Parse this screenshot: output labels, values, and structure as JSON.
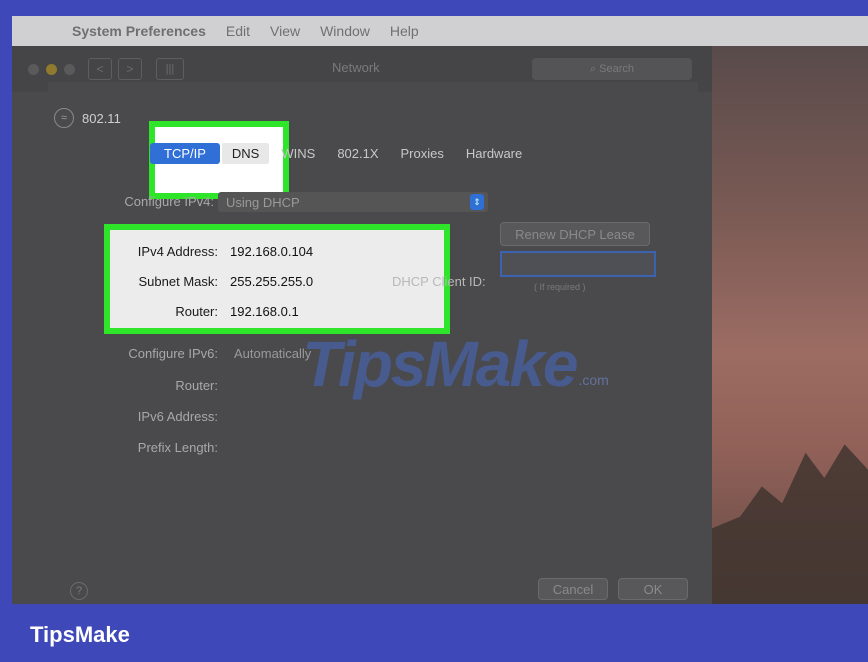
{
  "menubar": {
    "apple": "",
    "items": [
      "System Preferences",
      "Edit",
      "View",
      "Window",
      "Help"
    ]
  },
  "window": {
    "title": "Network",
    "search_placeholder": "Search",
    "nav_back": "<",
    "nav_forward": ">",
    "grid": "|||"
  },
  "interface": {
    "name": "802.11"
  },
  "tabs": [
    {
      "label": "TCP/IP",
      "active": true
    },
    {
      "label": "DNS"
    },
    {
      "label": "WINS"
    },
    {
      "label": "802.1X"
    },
    {
      "label": "Proxies"
    },
    {
      "label": "Hardware"
    }
  ],
  "ipv4": {
    "configure_label": "Configure IPv4:",
    "configure_value": "Using DHCP",
    "address_label": "IPv4 Address:",
    "address_value": "192.168.0.104",
    "subnet_label": "Subnet Mask:",
    "subnet_value": "255.255.255.0",
    "router_label": "Router:",
    "router_value": "192.168.0.1",
    "renew_button": "Renew DHCP Lease",
    "dhcp_client_label": "DHCP Client ID:",
    "dhcp_client_value": "",
    "dhcp_hint": "( If required )"
  },
  "ipv6": {
    "configure_label": "Configure IPv6:",
    "configure_value": "Automatically",
    "router_label": "Router:",
    "address_label": "IPv6 Address:",
    "prefix_label": "Prefix Length:"
  },
  "footer": {
    "help": "?",
    "cancel": "Cancel",
    "ok": "OK"
  },
  "watermark": {
    "text": "TipsMake",
    "suffix": ".com"
  },
  "brand": "TipsMake",
  "colors": {
    "highlight": "#2ee52a",
    "accent": "#2f6fd6",
    "brand_bar": "#3f48b9"
  }
}
